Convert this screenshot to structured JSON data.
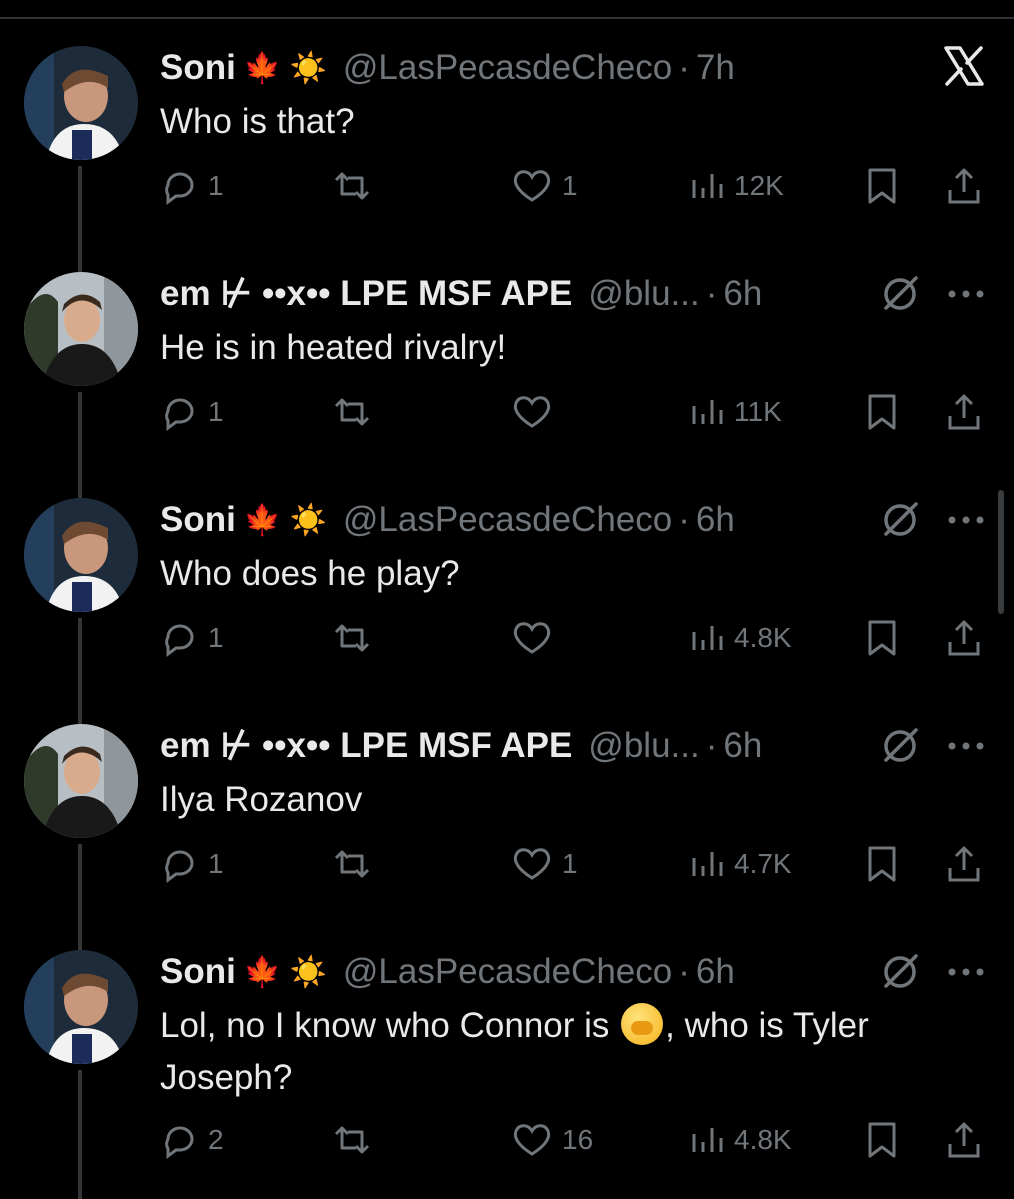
{
  "tweets": [
    {
      "name": "Soni",
      "emoji": "🍁 ☀️",
      "handle": "@LasPecasdeCheco",
      "dot": "·",
      "time": "7h",
      "text": "Who is that?",
      "replies": "1",
      "reposts": "",
      "likes": "1",
      "views": "12K"
    },
    {
      "name": "em ⊬ ••x•• LPE MSF APE",
      "emoji": "",
      "handle": "@blu...",
      "dot": "·",
      "time": "6h",
      "text": "He is in heated rivalry!",
      "replies": "1",
      "reposts": "",
      "likes": "",
      "views": "11K"
    },
    {
      "name": "Soni",
      "emoji": "🍁 ☀️",
      "handle": "@LasPecasdeCheco",
      "dot": "·",
      "time": "6h",
      "text": "Who does he play?",
      "replies": "1",
      "reposts": "",
      "likes": "",
      "views": "4.8K"
    },
    {
      "name": "em ⊬ ••x•• LPE MSF APE",
      "emoji": "",
      "handle": "@blu...",
      "dot": "·",
      "time": "6h",
      "text": "Ilya Rozanov",
      "replies": "1",
      "reposts": "",
      "likes": "1",
      "views": "4.7K"
    },
    {
      "name": "Soni",
      "emoji": "🍁 ☀️",
      "handle": "@LasPecasdeCheco",
      "dot": "·",
      "time": "6h",
      "text_before": "Lol, no I know who Connor is ",
      "text_after": ", who is Tyler Joseph?",
      "text_emoji": "face-with-hand-over-mouth",
      "replies": "2",
      "reposts": "",
      "likes": "16",
      "views": "4.8K"
    }
  ],
  "icons": {
    "close": "x-logo-icon",
    "reply": "reply-icon",
    "repost": "repost-icon",
    "like": "heart-icon",
    "views": "views-icon",
    "bookmark": "bookmark-icon",
    "share": "share-icon",
    "muted": "no-symbol-icon",
    "more": "more-icon"
  }
}
